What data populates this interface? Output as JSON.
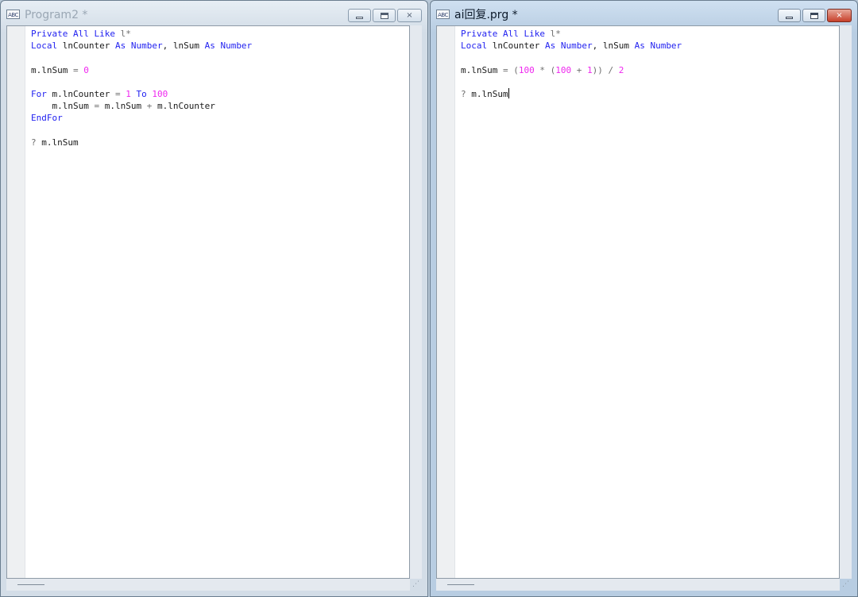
{
  "left_window": {
    "icon_text": "ABC",
    "title": "Program2 *",
    "active": false,
    "code_lines": [
      [
        {
          "t": "Private All Like",
          "c": "kw"
        },
        {
          "t": " l*",
          "c": "op"
        }
      ],
      [
        {
          "t": "Local",
          "c": "kw"
        },
        {
          "t": " lnCounter ",
          "c": ""
        },
        {
          "t": "As Number",
          "c": "kw"
        },
        {
          "t": ", lnSum ",
          "c": ""
        },
        {
          "t": "As Number",
          "c": "kw"
        }
      ],
      [],
      [
        {
          "t": "m.lnSum",
          "c": ""
        },
        {
          "t": " = ",
          "c": "op"
        },
        {
          "t": "0",
          "c": "num"
        }
      ],
      [],
      [
        {
          "t": "For",
          "c": "kw"
        },
        {
          "t": " m.lnCounter ",
          "c": ""
        },
        {
          "t": "=",
          "c": "op"
        },
        {
          "t": " ",
          "c": ""
        },
        {
          "t": "1",
          "c": "num"
        },
        {
          "t": " ",
          "c": ""
        },
        {
          "t": "To",
          "c": "kw"
        },
        {
          "t": " ",
          "c": ""
        },
        {
          "t": "100",
          "c": "num"
        }
      ],
      [
        {
          "t": "    m.lnSum ",
          "c": ""
        },
        {
          "t": "=",
          "c": "op"
        },
        {
          "t": " m.lnSum ",
          "c": ""
        },
        {
          "t": "+",
          "c": "op"
        },
        {
          "t": " m.lnCounter",
          "c": ""
        }
      ],
      [
        {
          "t": "EndFor",
          "c": "kw"
        }
      ],
      [],
      [
        {
          "t": "?",
          "c": "op"
        },
        {
          "t": " m.lnSum",
          "c": ""
        }
      ]
    ]
  },
  "right_window": {
    "icon_text": "ABC",
    "title": "ai回复.prg *",
    "active": true,
    "code_lines": [
      [
        {
          "t": "Private All Like",
          "c": "kw"
        },
        {
          "t": " l*",
          "c": "op"
        }
      ],
      [
        {
          "t": "Local",
          "c": "kw"
        },
        {
          "t": " lnCounter ",
          "c": ""
        },
        {
          "t": "As Number",
          "c": "kw"
        },
        {
          "t": ", lnSum ",
          "c": ""
        },
        {
          "t": "As Number",
          "c": "kw"
        }
      ],
      [],
      [
        {
          "t": "m.lnSum",
          "c": ""
        },
        {
          "t": " = (",
          "c": "op"
        },
        {
          "t": "100",
          "c": "num"
        },
        {
          "t": " * (",
          "c": "op"
        },
        {
          "t": "100",
          "c": "num"
        },
        {
          "t": " + ",
          "c": "op"
        },
        {
          "t": "1",
          "c": "num"
        },
        {
          "t": ")) / ",
          "c": "op"
        },
        {
          "t": "2",
          "c": "num"
        }
      ],
      [],
      [
        {
          "t": "?",
          "c": "op"
        },
        {
          "t": " m.lnSum",
          "c": "",
          "caret": true
        }
      ]
    ]
  },
  "caption_buttons": {
    "minimize": "minimize",
    "maximize": "maximize",
    "close": "×"
  },
  "size_grip": "⋰"
}
